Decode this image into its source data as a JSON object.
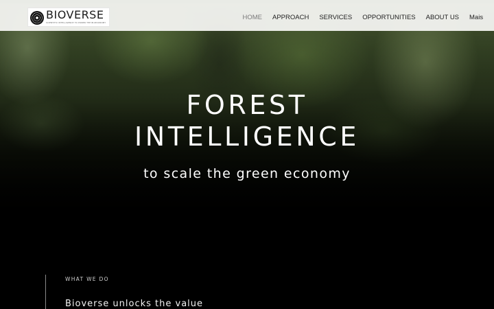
{
  "header": {
    "logo": {
      "name": "BIOVERSE",
      "tagline": "SCIENTIFIC INTELLIGENCE TO POWER THE BIOECONOMY",
      "icon": "mandala-logo-icon"
    },
    "nav": {
      "items": [
        {
          "label": "HOME",
          "active": true
        },
        {
          "label": "APPROACH",
          "active": false
        },
        {
          "label": "SERVICES",
          "active": false
        },
        {
          "label": "OPPORTUNITIES",
          "active": false
        },
        {
          "label": "ABOUT US",
          "active": false
        },
        {
          "label": "Mais",
          "active": false
        }
      ]
    }
  },
  "hero": {
    "title_line1": "FOREST",
    "title_line2": "INTELLIGENCE",
    "subtitle": "to scale the green economy"
  },
  "what_we_do": {
    "label": "WHAT WE DO",
    "text": "Bioverse unlocks the value"
  },
  "colors": {
    "header_bg": "#f8f8f5",
    "nav_text": "#222222",
    "nav_active": "#7a7a7a",
    "hero_text": "#ffffff",
    "page_bg": "#000000"
  }
}
